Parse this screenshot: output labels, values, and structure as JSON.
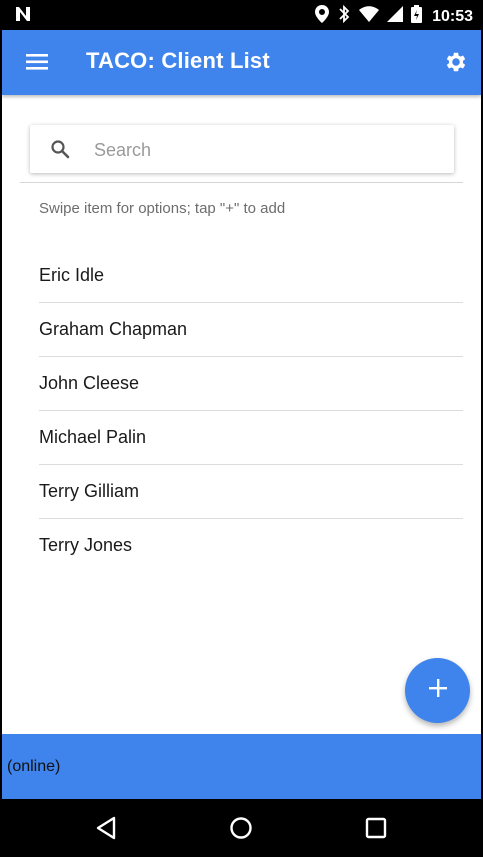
{
  "status_bar": {
    "time": "10:53",
    "icons": [
      "notification-n-icon",
      "location-icon",
      "bluetooth-icon",
      "wifi-icon",
      "signal-icon",
      "battery-icon"
    ]
  },
  "app_bar": {
    "title": "TACO: Client List",
    "menu_icon": "hamburger-menu-icon",
    "settings_icon": "gear-icon"
  },
  "search": {
    "placeholder": "Search",
    "value": "",
    "icon": "search-icon"
  },
  "hint": "Swipe item for options; tap \"+\" to add",
  "clients": [
    {
      "name": "Eric Idle"
    },
    {
      "name": "Graham Chapman"
    },
    {
      "name": "John Cleese"
    },
    {
      "name": "Michael Palin"
    },
    {
      "name": "Terry Gilliam"
    },
    {
      "name": "Terry Jones"
    }
  ],
  "fab": {
    "icon": "plus-icon"
  },
  "footer": {
    "status": "(online)"
  },
  "nav_bar": {
    "icons": [
      "back-icon",
      "home-icon",
      "recents-icon"
    ]
  },
  "colors": {
    "primary": "#3f84ec",
    "background": "#ffffff",
    "divider": "#dcdcdc"
  }
}
